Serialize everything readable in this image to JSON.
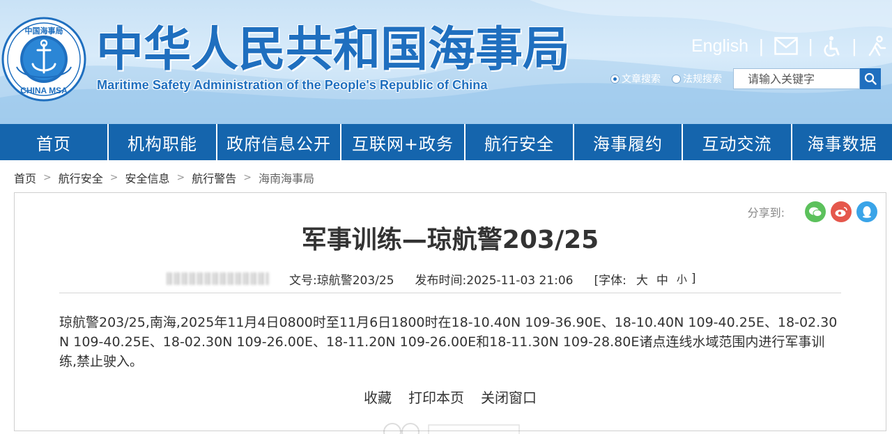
{
  "header": {
    "site_title": "中华人民共和国海事局",
    "site_subtitle": "Maritime Safety Administration of the People's Republic of China",
    "logo_top_text": "中国海事局",
    "logo_bottom_text": "CHINA MSA",
    "english_link": "English",
    "icons": [
      "mail-icon",
      "accessibility-icon",
      "elderly-icon"
    ],
    "search": {
      "options": [
        "文章搜索",
        "法规搜索"
      ],
      "selected": "文章搜索",
      "placeholder": "请输入关键字"
    }
  },
  "nav": {
    "items": [
      "首页",
      "机构职能",
      "政府信息公开",
      "互联网+政务",
      "航行安全",
      "海事履约",
      "互动交流",
      "海事数据"
    ]
  },
  "breadcrumb": [
    "首页",
    "航行安全",
    "安全信息",
    "航行警告",
    "海南海事局"
  ],
  "article": {
    "share_label": "分享到:",
    "share_icons": [
      "wechat-icon",
      "weibo-icon",
      "qq-icon"
    ],
    "title": "军事训练—琼航警203/25",
    "doc_no": "文号:琼航警203/25",
    "publish_time": "发布时间:2025-11-03 21:06",
    "font_label": "[字体:",
    "font_large": "大",
    "font_medium": "中",
    "font_small": "小",
    "font_close": "]",
    "body": "琼航警203/25,南海,2025年11月4日0800时至11月6日1800时在18-10.40N 109-36.90E、18-10.40N 109-40.25E、18-02.30N 109-40.25E、18-02.30N 109-26.00E、18-11.20N 109-26.00E和18-11.30N 109-28.80E诸点连线水域范围内进行军事训练,禁止驶入。",
    "actions": [
      "收藏",
      "打印本页",
      "关闭窗口"
    ]
  },
  "colors": {
    "brand_blue": "#1f6fbf",
    "nav_blue": "#1565ad",
    "wechat": "#5cc15c",
    "weibo": "#e5574c",
    "qq": "#3aa4e8"
  }
}
